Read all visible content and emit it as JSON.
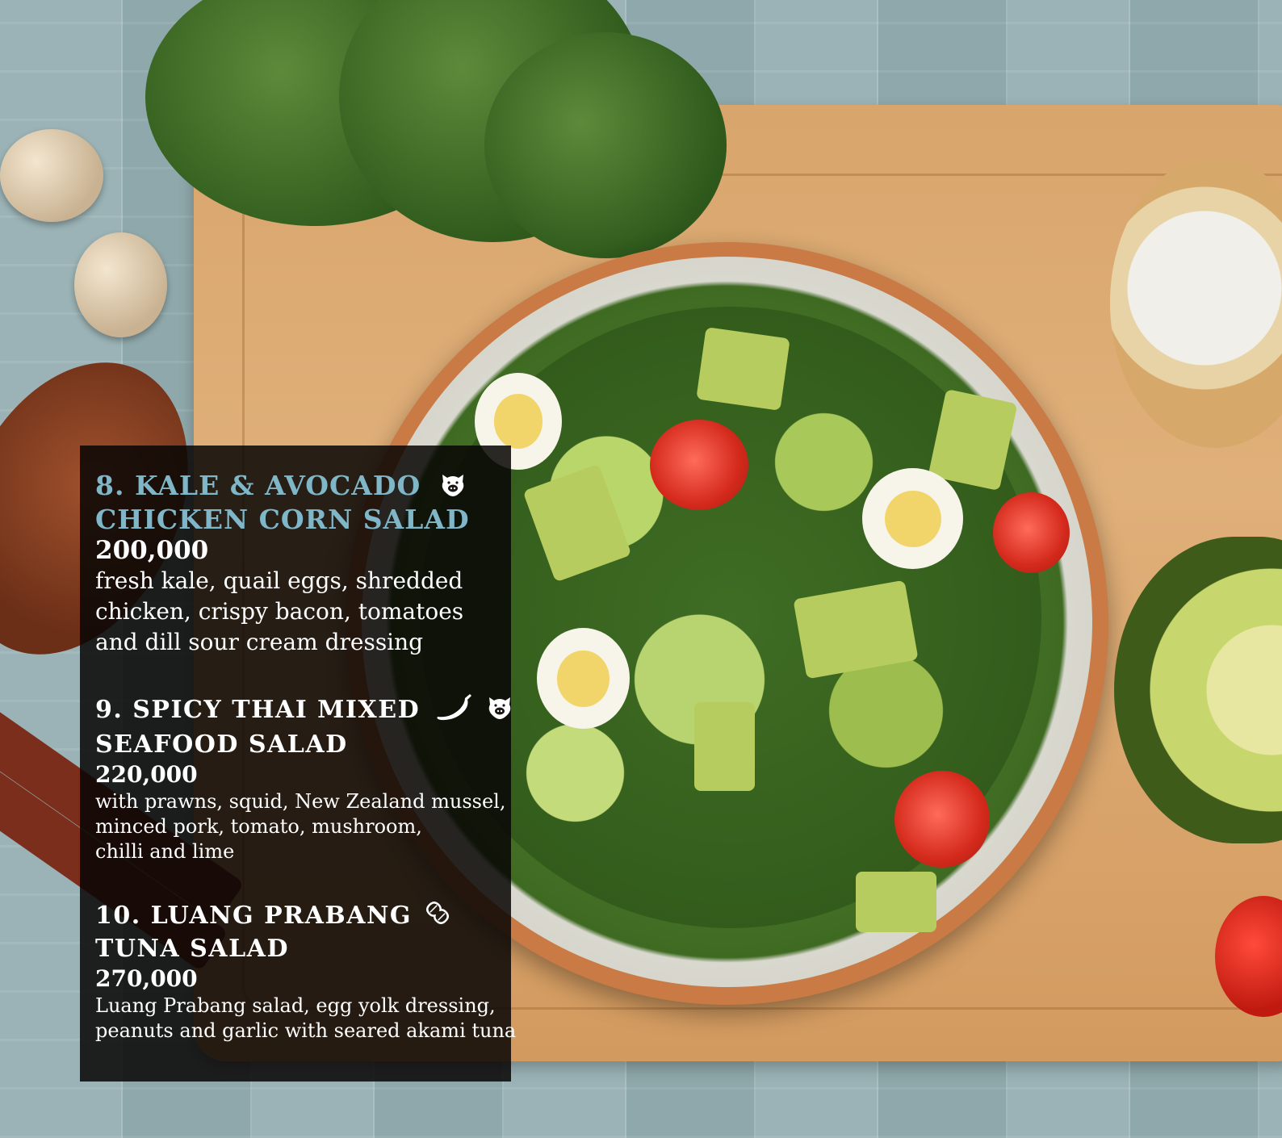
{
  "menu": {
    "items": [
      {
        "title_line1": "8. KALE & AVOCADO",
        "title_line2": "CHICKEN CORN SALAD",
        "price": "200,000",
        "description": [
          "fresh kale, quail eggs, shredded",
          "chicken, crispy bacon, tomatoes",
          "and dill sour cream dressing"
        ],
        "icons": [
          "pork-icon"
        ]
      },
      {
        "title_line1": "9. SPICY THAI MIXED",
        "title_line2": "SEAFOOD SALAD",
        "price": "220,000",
        "description": [
          "with prawns, squid, New Zealand mussel,",
          "minced pork, tomato, mushroom,",
          "chilli and lime"
        ],
        "icons": [
          "chili-icon",
          "pork-icon"
        ]
      },
      {
        "title_line1": "10. LUANG PRABANG",
        "title_line2": "TUNA SALAD",
        "price": "270,000",
        "description": [
          "Luang Prabang salad, egg yolk dressing,",
          "peanuts and garlic with seared akami tuna"
        ],
        "icons": [
          "peanut-icon"
        ]
      }
    ]
  },
  "colors": {
    "title_accent": "#7fb6c8",
    "panel_bg": "#080605"
  }
}
